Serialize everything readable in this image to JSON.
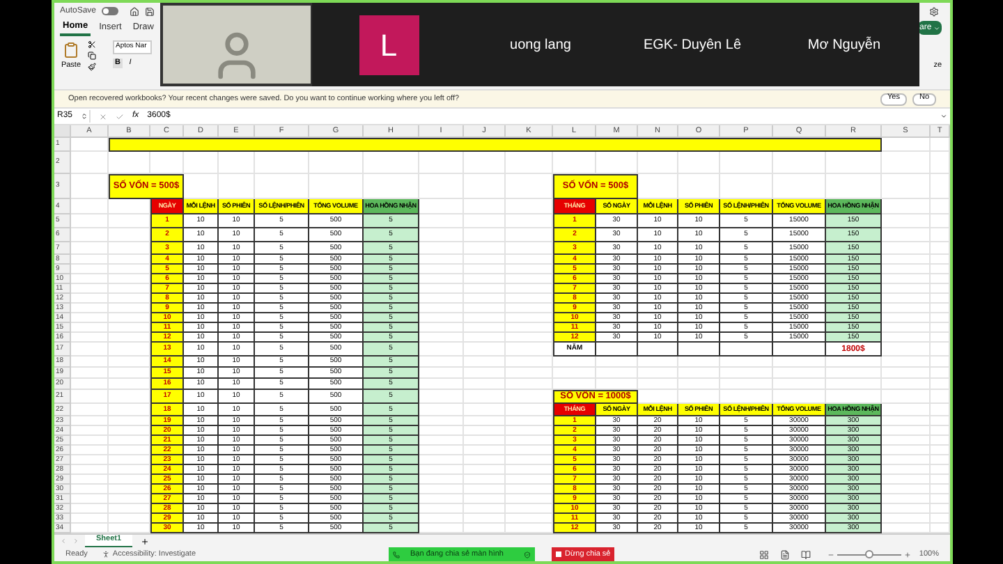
{
  "toolbar": {
    "autosave": {
      "label": "AutoSave",
      "on": false
    },
    "tabs": [
      {
        "label": "Home",
        "selected": true
      },
      {
        "label": "Insert",
        "selected": false
      },
      {
        "label": "Draw",
        "selected": false
      }
    ],
    "paste_label": "Paste",
    "font_name": "Aptos Nar",
    "bold_label": "B",
    "italic_label": "I",
    "share_label": "are",
    "ribbon_fragment": "ze"
  },
  "video_call": {
    "participants": [
      {
        "kind": "video",
        "speaking": true
      },
      {
        "kind": "avatar",
        "initial": "L",
        "speaking": false
      },
      {
        "kind": "name",
        "name": "uong lang",
        "speaking": false
      },
      {
        "kind": "name",
        "name": "EGK- Duyên Lê",
        "speaking": false
      },
      {
        "kind": "name",
        "name": "Mơ Nguyễn",
        "speaking": false
      }
    ]
  },
  "notification": {
    "title": "Open recovered workbooks?",
    "message": "Your recent changes were saved. Do you want to continue working where you left off?",
    "buttons": [
      "Yes",
      "No"
    ]
  },
  "formula_bar": {
    "cell_ref": "R35",
    "fx": "fx",
    "value": "3600$"
  },
  "sheet": {
    "columns": [
      "A",
      "B",
      "C",
      "D",
      "E",
      "F",
      "G",
      "H",
      "I",
      "J",
      "K",
      "L",
      "M",
      "N",
      "O",
      "P",
      "Q",
      "R",
      "S",
      "T"
    ],
    "rows": [
      "1",
      "2",
      "3",
      "4",
      "5",
      "6",
      "7",
      "8",
      "9",
      "10",
      "11",
      "12",
      "13",
      "14",
      "15",
      "16",
      "17",
      "18",
      "19",
      "20",
      "21",
      "22",
      "23",
      "24",
      "25",
      "26",
      "27",
      "28",
      "29",
      "30",
      "31",
      "32",
      "33",
      "34"
    ],
    "tables": [
      {
        "caption": "SỐ VỐN = 500$",
        "headers": [
          "NGÀY",
          "MỖI LỆNH",
          "SỐ PHIÊN",
          "SỐ LỆNH/PHIÊN",
          "TỔNG VOLUME",
          "HOA HỒNG NHẬN"
        ],
        "rows": [
          [
            "1",
            "10",
            "10",
            "5",
            "500",
            "5"
          ],
          [
            "2",
            "10",
            "10",
            "5",
            "500",
            "5"
          ],
          [
            "3",
            "10",
            "10",
            "5",
            "500",
            "5"
          ],
          [
            "4",
            "10",
            "10",
            "5",
            "500",
            "5"
          ],
          [
            "5",
            "10",
            "10",
            "5",
            "500",
            "5"
          ],
          [
            "6",
            "10",
            "10",
            "5",
            "500",
            "5"
          ],
          [
            "7",
            "10",
            "10",
            "5",
            "500",
            "5"
          ],
          [
            "8",
            "10",
            "10",
            "5",
            "500",
            "5"
          ],
          [
            "9",
            "10",
            "10",
            "5",
            "500",
            "5"
          ],
          [
            "10",
            "10",
            "10",
            "5",
            "500",
            "5"
          ],
          [
            "11",
            "10",
            "10",
            "5",
            "500",
            "5"
          ],
          [
            "12",
            "10",
            "10",
            "5",
            "500",
            "5"
          ],
          [
            "13",
            "10",
            "10",
            "5",
            "500",
            "5"
          ],
          [
            "14",
            "10",
            "10",
            "5",
            "500",
            "5"
          ],
          [
            "15",
            "10",
            "10",
            "5",
            "500",
            "5"
          ],
          [
            "16",
            "10",
            "10",
            "5",
            "500",
            "5"
          ],
          [
            "17",
            "10",
            "10",
            "5",
            "500",
            "5"
          ],
          [
            "18",
            "10",
            "10",
            "5",
            "500",
            "5"
          ],
          [
            "19",
            "10",
            "10",
            "5",
            "500",
            "5"
          ],
          [
            "20",
            "10",
            "10",
            "5",
            "500",
            "5"
          ],
          [
            "21",
            "10",
            "10",
            "5",
            "500",
            "5"
          ],
          [
            "22",
            "10",
            "10",
            "5",
            "500",
            "5"
          ],
          [
            "23",
            "10",
            "10",
            "5",
            "500",
            "5"
          ],
          [
            "24",
            "10",
            "10",
            "5",
            "500",
            "5"
          ],
          [
            "25",
            "10",
            "10",
            "5",
            "500",
            "5"
          ],
          [
            "26",
            "10",
            "10",
            "5",
            "500",
            "5"
          ],
          [
            "27",
            "10",
            "10",
            "5",
            "500",
            "5"
          ],
          [
            "28",
            "10",
            "10",
            "5",
            "500",
            "5"
          ],
          [
            "29",
            "10",
            "10",
            "5",
            "500",
            "5"
          ],
          [
            "30",
            "10",
            "10",
            "5",
            "500",
            "5"
          ]
        ]
      },
      {
        "caption": "SỐ VỐN = 500$",
        "headers": [
          "THÁNG",
          "SỐ NGÀY",
          "MỖI LỆNH",
          "SỐ PHIÊN",
          "SỐ LỆNH/PHIÊN",
          "TỔNG VOLUME",
          "HOA HỒNG NHẬN"
        ],
        "rows": [
          [
            "1",
            "30",
            "10",
            "10",
            "5",
            "15000",
            "150"
          ],
          [
            "2",
            "30",
            "10",
            "10",
            "5",
            "15000",
            "150"
          ],
          [
            "3",
            "30",
            "10",
            "10",
            "5",
            "15000",
            "150"
          ],
          [
            "4",
            "30",
            "10",
            "10",
            "5",
            "15000",
            "150"
          ],
          [
            "5",
            "30",
            "10",
            "10",
            "5",
            "15000",
            "150"
          ],
          [
            "6",
            "30",
            "10",
            "10",
            "5",
            "15000",
            "150"
          ],
          [
            "7",
            "30",
            "10",
            "10",
            "5",
            "15000",
            "150"
          ],
          [
            "8",
            "30",
            "10",
            "10",
            "5",
            "15000",
            "150"
          ],
          [
            "9",
            "30",
            "10",
            "10",
            "5",
            "15000",
            "150"
          ],
          [
            "10",
            "30",
            "10",
            "10",
            "5",
            "15000",
            "150"
          ],
          [
            "11",
            "30",
            "10",
            "10",
            "5",
            "15000",
            "150"
          ],
          [
            "12",
            "30",
            "10",
            "10",
            "5",
            "15000",
            "150"
          ]
        ],
        "footer": {
          "label": "NĂM",
          "total": "1800$"
        }
      },
      {
        "caption": "SỐ VỐN = 1000$",
        "headers": [
          "THÁNG",
          "SỐ NGÀY",
          "MỖI LỆNH",
          "SỐ PHIÊN",
          "SỐ LỆNH/PHIÊN",
          "TỔNG VOLUME",
          "HOA HỒNG NHẬN"
        ],
        "rows": [
          [
            "1",
            "30",
            "20",
            "10",
            "5",
            "30000",
            "300"
          ],
          [
            "2",
            "30",
            "20",
            "10",
            "5",
            "30000",
            "300"
          ],
          [
            "3",
            "30",
            "20",
            "10",
            "5",
            "30000",
            "300"
          ],
          [
            "4",
            "30",
            "20",
            "10",
            "5",
            "30000",
            "300"
          ],
          [
            "5",
            "30",
            "20",
            "10",
            "5",
            "30000",
            "300"
          ],
          [
            "6",
            "30",
            "20",
            "10",
            "5",
            "30000",
            "300"
          ],
          [
            "7",
            "30",
            "20",
            "10",
            "5",
            "30000",
            "300"
          ],
          [
            "8",
            "30",
            "20",
            "10",
            "5",
            "30000",
            "300"
          ],
          [
            "9",
            "30",
            "20",
            "10",
            "5",
            "30000",
            "300"
          ],
          [
            "10",
            "30",
            "20",
            "10",
            "5",
            "30000",
            "300"
          ],
          [
            "11",
            "30",
            "20",
            "10",
            "5",
            "30000",
            "300"
          ],
          [
            "12",
            "30",
            "20",
            "10",
            "5",
            "30000",
            "300"
          ]
        ]
      }
    ]
  },
  "sheet_tabs": [
    {
      "label": "Sheet1",
      "selected": true
    }
  ],
  "status_bar": {
    "status": "Ready",
    "accessibility": "Accessibility: Investigate",
    "sharing": "Bạn đang chia sẻ màn hình",
    "stop_sharing": "Dừng chia sẻ",
    "zoom": {
      "level": 0.5,
      "reading": "100%"
    }
  }
}
